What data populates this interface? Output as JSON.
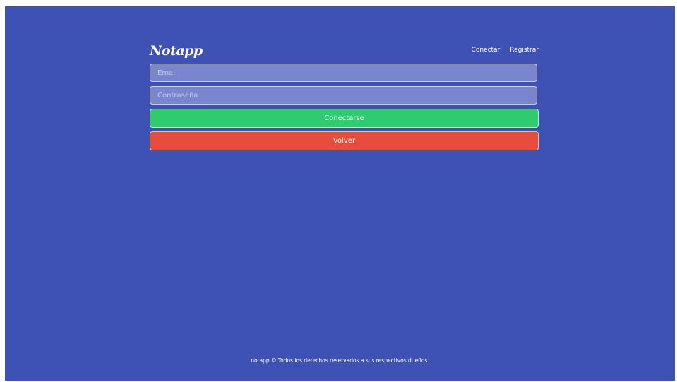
{
  "app": {
    "logo_text": "Notapp"
  },
  "nav": {
    "connect_label": "Conectar",
    "register_label": "Registrar"
  },
  "form": {
    "email_placeholder": "Email",
    "email_value": "",
    "password_placeholder": "Contraseña",
    "password_value": "",
    "submit_label": "Conectarse",
    "back_label": "Volver"
  },
  "footer": {
    "text": "notapp © Todos los derechos reservados a sus respectivos dueños."
  },
  "colors": {
    "background": "#3e51b5",
    "input_bg": "#7985cc",
    "primary": "#2ecc71",
    "danger": "#e74c3c"
  }
}
